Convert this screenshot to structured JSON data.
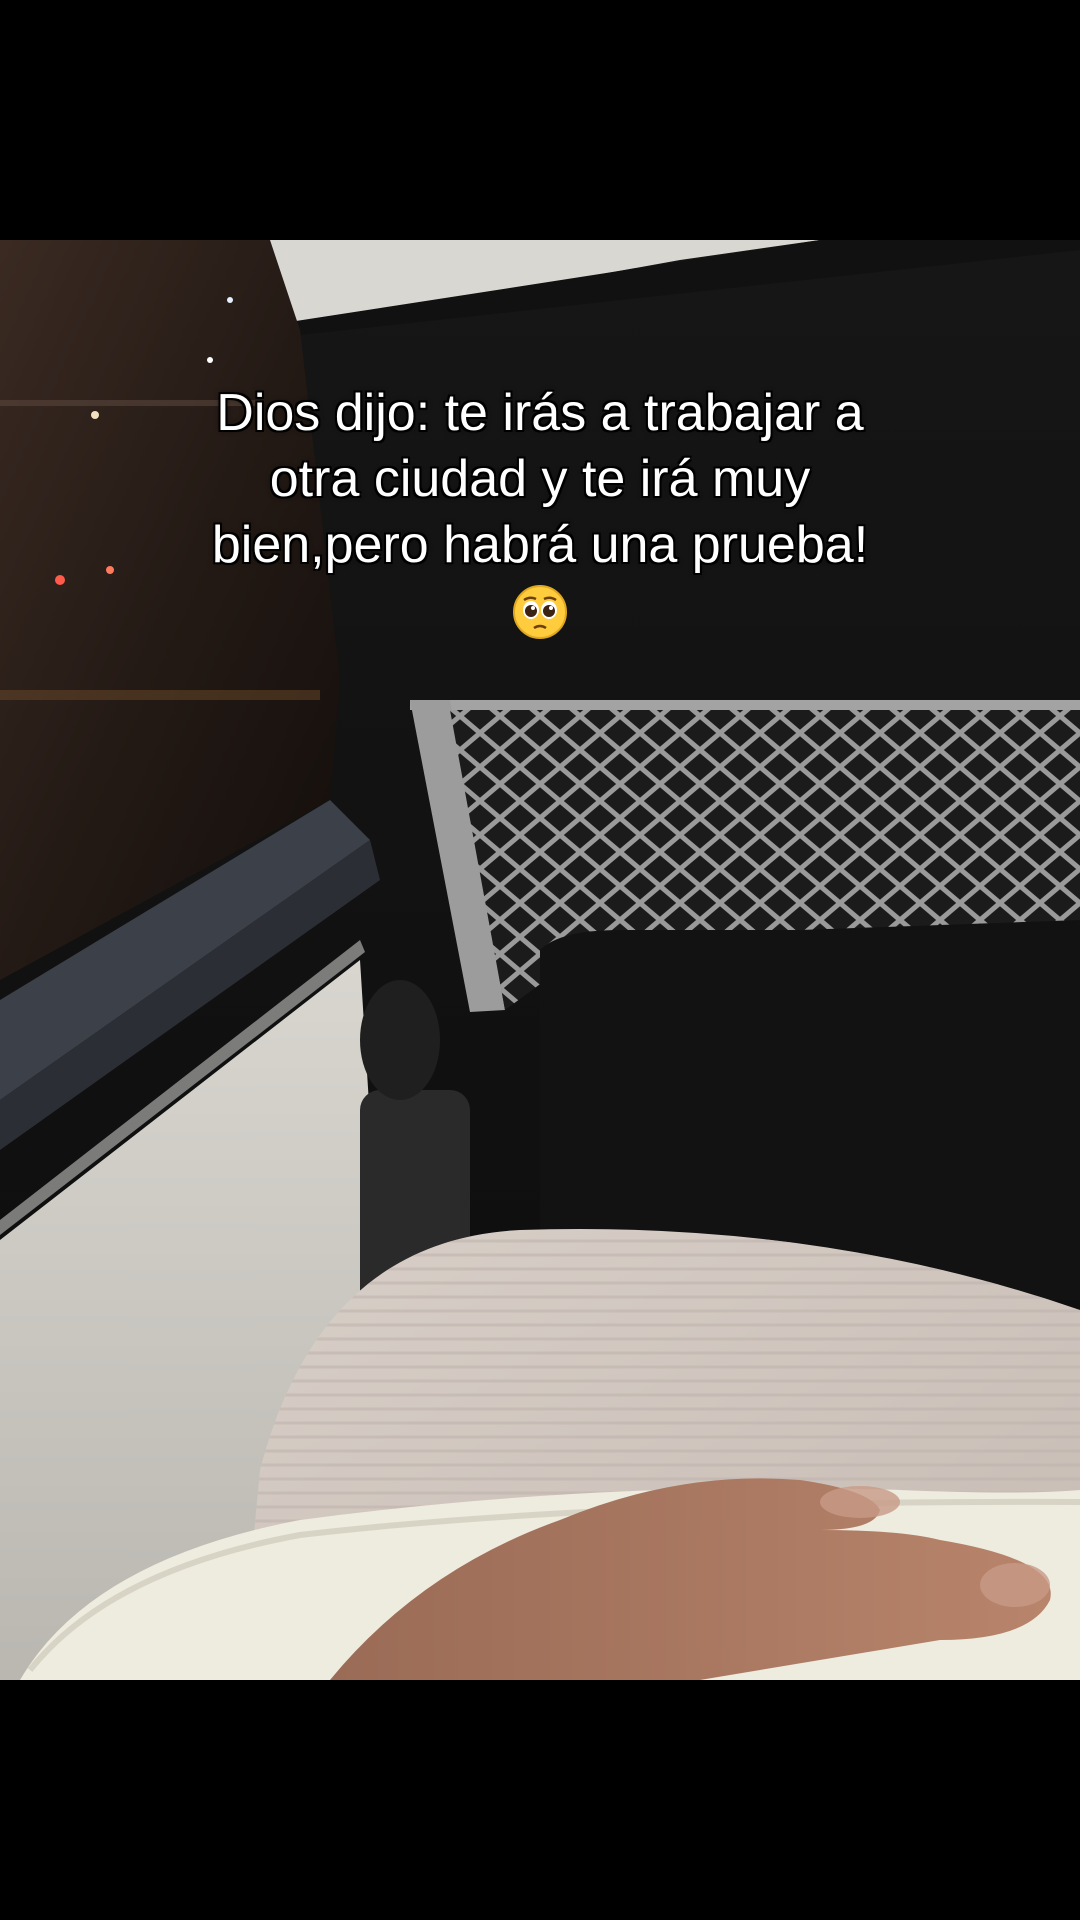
{
  "caption": {
    "lines": [
      "Dios dijo: te irás a trabajar a",
      "otra ciudad y te irá muy",
      "bien,pero habrá una prueba!"
    ],
    "emoji": "pleading-face-emoji"
  },
  "colors": {
    "letterbox": "#000000",
    "caption_text": "#ffffff",
    "caption_outline": "#000000"
  }
}
